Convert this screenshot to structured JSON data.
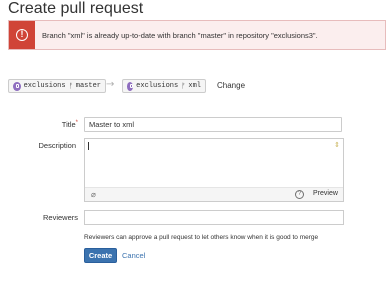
{
  "page": {
    "title": "Create pull request"
  },
  "alert": {
    "message": "Branch \"xml\" is already up-to-date with branch \"master\" in repository \"exclusions3\".",
    "icon": "error-icon",
    "color": "#d04437"
  },
  "branches": {
    "source": {
      "repo": "exclusions",
      "branch": "master"
    },
    "target": {
      "repo": "exclusions",
      "branch": "xml"
    },
    "change_label": "Change"
  },
  "form": {
    "title_label": "Title",
    "title_required_mark": "*",
    "title_value": "Master to xml",
    "description_label": "Description",
    "description_value": "",
    "preview_label": "Preview",
    "help_glyph": "?",
    "reviewers_label": "Reviewers",
    "reviewers_value": "",
    "reviewers_help": "Reviewers can approve a pull request to let others know when it is good to merge",
    "create_label": "Create",
    "cancel_label": "Cancel"
  },
  "colors": {
    "primary": "#3b73af",
    "error": "#d04437",
    "repo_avatar": "#8e6dbf"
  }
}
